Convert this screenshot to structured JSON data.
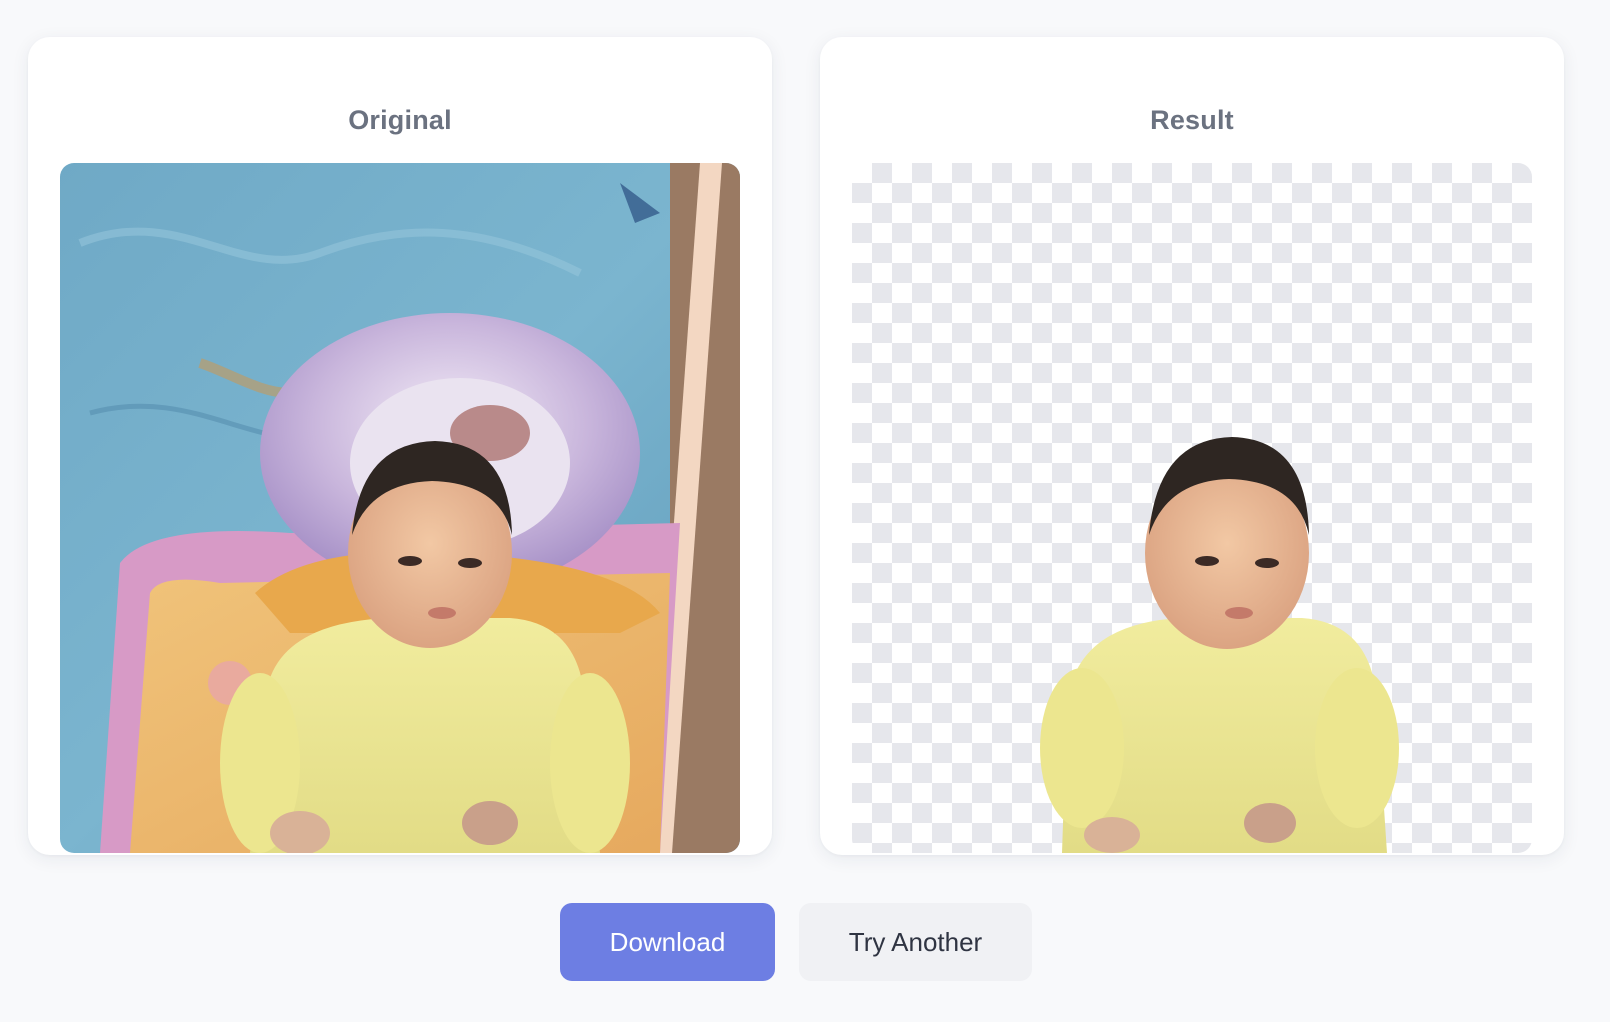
{
  "panels": {
    "original": {
      "title": "Original"
    },
    "result": {
      "title": "Result"
    }
  },
  "actions": {
    "download_label": "Download",
    "try_another_label": "Try Another"
  },
  "colors": {
    "primary_button": "#6d7ee3",
    "secondary_button": "#f0f1f4",
    "title_text": "#6b7280",
    "page_background": "#f8f9fb"
  }
}
